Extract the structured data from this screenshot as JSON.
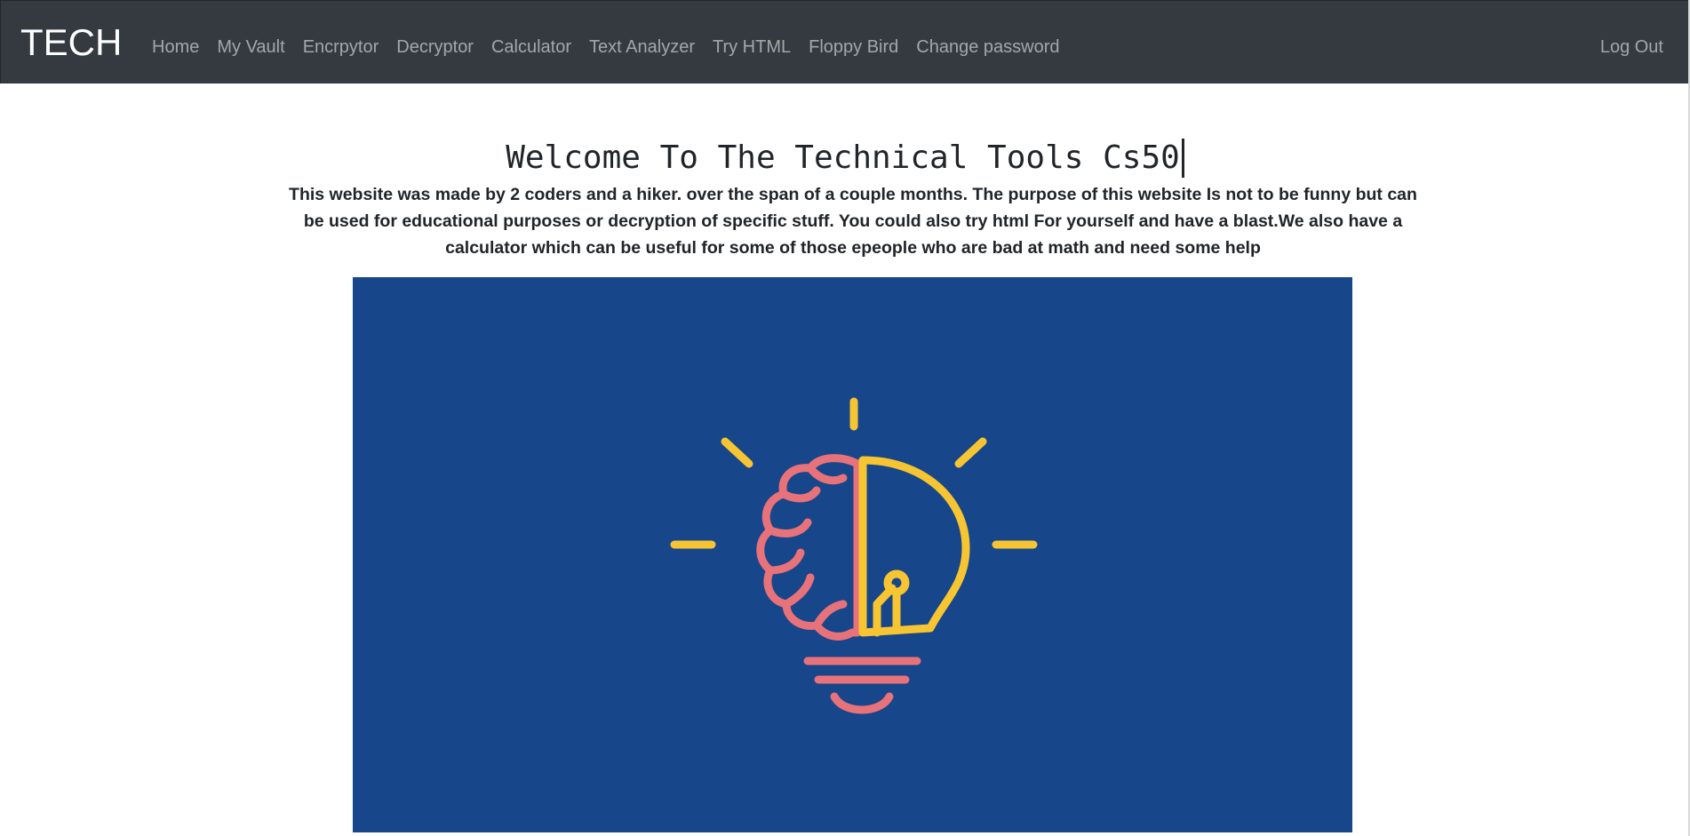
{
  "navbar": {
    "brand": "TECH",
    "links": [
      "Home",
      "My Vault",
      "Encrpytor",
      "Decryptor",
      "Calculator",
      "Text Analyzer",
      "Try HTML",
      "Floppy Bird",
      "Change password"
    ],
    "logout": "Log Out"
  },
  "main": {
    "title": "Welcome To The Technical Tools Cs50",
    "intro": "This website was made by 2 coders and a hiker. over the span of a couple months. The purpose of this website Is not to be funny but can be used for educational purposes or decryption of specific stuff. You could also try html For yourself and have a blast.We also have a calculator which can be useful for some of those epeople who are bad at math and need some help",
    "hero_image": {
      "icon": "brain-lightbulb-icon",
      "background": "#18468a",
      "brain_color": "#e8727a",
      "bulb_color": "#f7c532"
    }
  }
}
